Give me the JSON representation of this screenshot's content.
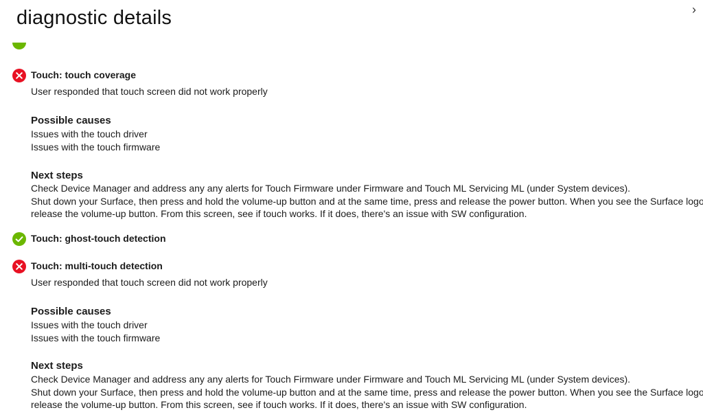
{
  "header": {
    "title": "diagnostic details",
    "close_glyph": "›"
  },
  "colors": {
    "pass": "#6bb700",
    "fail": "#e81123"
  },
  "icons": {
    "pass": "check-circle-icon",
    "fail": "error-circle-icon"
  },
  "results": [
    {
      "status": "fail",
      "title": "Touch: touch coverage",
      "detail": "User responded that touch screen did not work properly",
      "causes_heading": "Possible causes",
      "causes": [
        "Issues with the touch driver",
        "Issues with the touch firmware"
      ],
      "steps_heading": "Next steps",
      "steps": [
        "Check Device Manager and address any any alerts for Touch Firmware under Firmware and Touch ML Servicing ML (under System devices).",
        "Shut down your Surface, then press and hold the volume-up button and at the same time, press and release the power button. When you see the Surface logo,",
        "release the volume-up button. From this screen, see if touch works. If it does, there's an issue with SW configuration."
      ]
    },
    {
      "status": "pass",
      "title": "Touch: ghost-touch detection"
    },
    {
      "status": "fail",
      "title": "Touch: multi-touch detection",
      "detail": "User responded that touch screen did not work properly",
      "causes_heading": "Possible causes",
      "causes": [
        "Issues with the touch driver",
        "Issues with the touch firmware"
      ],
      "steps_heading": "Next steps",
      "steps": [
        "Check Device Manager and address any any alerts for Touch Firmware under Firmware and Touch ML Servicing ML (under System devices).",
        "Shut down your Surface, then press and hold the volume-up button and at the same time, press and release the power button. When you see the Surface logo,",
        "release the volume-up button. From this screen, see if touch works. If it does, there's an issue with SW configuration."
      ]
    }
  ]
}
